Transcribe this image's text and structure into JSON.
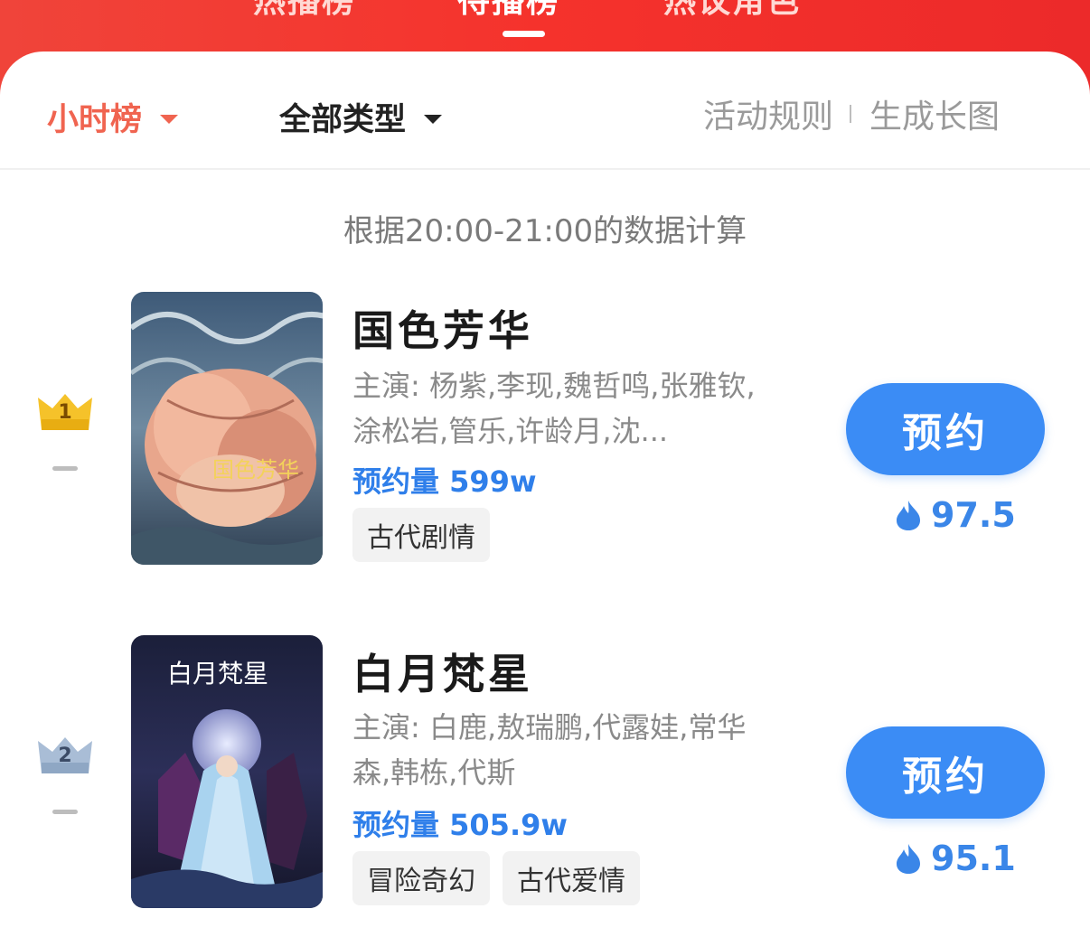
{
  "header": {
    "tabs": [
      {
        "label": "热播榜",
        "active": false
      },
      {
        "label": "待播榜",
        "active": true
      },
      {
        "label": "热议角色",
        "active": false
      }
    ]
  },
  "filters": {
    "period": "小时榜",
    "category": "全部类型"
  },
  "links": {
    "rules": "活动规则",
    "long_image": "生成长图"
  },
  "note": "根据20:00-21:00的数据计算",
  "items": [
    {
      "rank": "1",
      "title": "国色芳华",
      "cast": "主演: 杨紫,李现,魏哲鸣,张雅钦,涂松岩,管乐,许龄月,沈...",
      "reservations_label": "预约量 599w",
      "tags": [
        "古代剧情"
      ],
      "button": "预约",
      "heat": "97.5",
      "poster_text": "国色芳华"
    },
    {
      "rank": "2",
      "title": "白月梵星",
      "cast": "主演: 白鹿,敖瑞鹏,代露娃,常华森,韩栋,代斯",
      "reservations_label": "预约量 505.9w",
      "tags": [
        "冒险奇幻",
        "古代爱情"
      ],
      "button": "预约",
      "heat": "95.1",
      "poster_text": "白月梵星"
    }
  ],
  "colors": {
    "brand_red": "#f0443a",
    "accent_blue": "#3b8cf5",
    "gold": "#f5c22a",
    "silver": "#8fa7c4"
  },
  "icons": {
    "rank_crown": "crown-icon",
    "heat": "flame-icon",
    "dropdown": "caret-down-icon"
  }
}
